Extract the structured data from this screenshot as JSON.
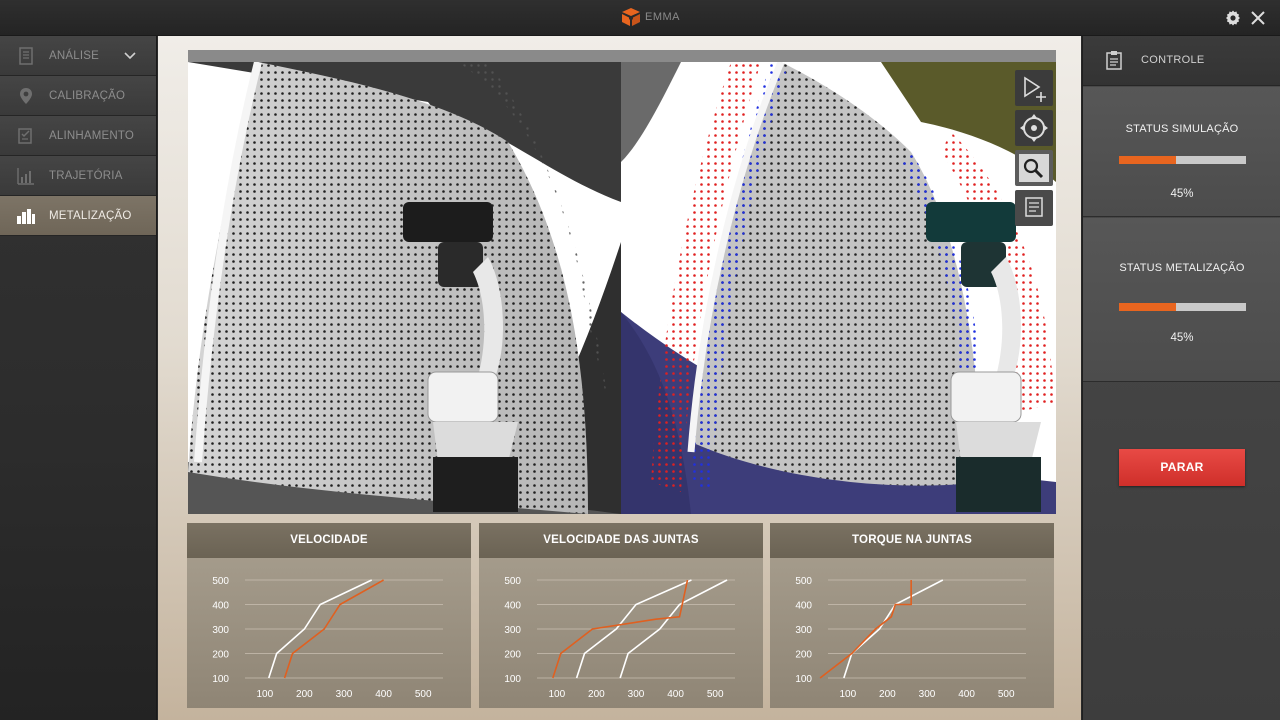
{
  "app": {
    "title": "EMMA"
  },
  "sidebar": {
    "items": [
      {
        "label": "ANÁLISE",
        "icon": "document-icon",
        "active": false,
        "has_dropdown": true
      },
      {
        "label": "CALIBRAÇÃO",
        "icon": "location-pin-icon",
        "active": false
      },
      {
        "label": "ALINHAMENTO",
        "icon": "checklist-icon",
        "active": false
      },
      {
        "label": "TRAJETÓRIA",
        "icon": "chart-icon",
        "active": false
      },
      {
        "label": "METALIZAÇÃO",
        "icon": "bars-icon",
        "active": true
      }
    ]
  },
  "viewport": {
    "tools": [
      "select-move-icon",
      "pan-icon",
      "zoom-icon",
      "list-icon"
    ]
  },
  "charts": [
    {
      "title": "VELOCIDADE",
      "chart_data": {
        "type": "line",
        "xlim": [
          50,
          550
        ],
        "ylim": [
          100,
          500
        ],
        "x_ticks": [
          100,
          200,
          300,
          400,
          500
        ],
        "y_ticks": [
          100,
          200,
          300,
          400,
          500
        ],
        "series": [
          {
            "color": "#ffffff",
            "points": [
              [
                110,
                100
              ],
              [
                130,
                200
              ],
              [
                200,
                300
              ],
              [
                240,
                400
              ],
              [
                370,
                500
              ]
            ]
          },
          {
            "color": "#e06020",
            "points": [
              [
                150,
                100
              ],
              [
                170,
                200
              ],
              [
                250,
                300
              ],
              [
                290,
                400
              ],
              [
                400,
                500
              ]
            ]
          }
        ]
      }
    },
    {
      "title": "VELOCIDADE DAS JUNTAS",
      "chart_data": {
        "type": "line",
        "xlim": [
          50,
          550
        ],
        "ylim": [
          100,
          500
        ],
        "x_ticks": [
          100,
          200,
          300,
          400,
          500
        ],
        "y_ticks": [
          100,
          200,
          300,
          400,
          500
        ],
        "series": [
          {
            "color": "#ffffff",
            "points": [
              [
                150,
                100
              ],
              [
                170,
                200
              ],
              [
                250,
                300
              ],
              [
                300,
                400
              ],
              [
                440,
                500
              ]
            ]
          },
          {
            "color": "#ffffff",
            "points": [
              [
                260,
                100
              ],
              [
                280,
                200
              ],
              [
                360,
                300
              ],
              [
                410,
                400
              ],
              [
                530,
                500
              ]
            ]
          },
          {
            "color": "#e06020",
            "points": [
              [
                90,
                100
              ],
              [
                110,
                200
              ],
              [
                190,
                300
              ],
              [
                350,
                340
              ],
              [
                410,
                350
              ],
              [
                430,
                500
              ]
            ]
          }
        ]
      }
    },
    {
      "title": "TORQUE NA JUNTAS",
      "chart_data": {
        "type": "line",
        "xlim": [
          50,
          550
        ],
        "ylim": [
          100,
          500
        ],
        "x_ticks": [
          100,
          200,
          300,
          400,
          500
        ],
        "y_ticks": [
          100,
          200,
          300,
          400,
          500
        ],
        "series": [
          {
            "color": "#ffffff",
            "points": [
              [
                90,
                100
              ],
              [
                110,
                200
              ],
              [
                180,
                300
              ],
              [
                220,
                400
              ],
              [
                340,
                500
              ]
            ]
          },
          {
            "color": "#e06020",
            "points": [
              [
                30,
                100
              ],
              [
                110,
                200
              ],
              [
                170,
                300
              ],
              [
                210,
                350
              ],
              [
                220,
                400
              ],
              [
                260,
                400
              ],
              [
                260,
                500
              ]
            ]
          }
        ]
      }
    }
  ],
  "control": {
    "title": "CONTROLE",
    "simulation": {
      "title": "STATUS SIMULAÇÃO",
      "progress": 0.45,
      "percent": "45%"
    },
    "metallization": {
      "title": "STATUS METALIZAÇÃO",
      "progress": 0.45,
      "percent": "45%"
    },
    "stop_label": "PARAR"
  },
  "colors": {
    "accent": "#e8651f",
    "stop": "#e0403a",
    "active_nav": "#776e60"
  }
}
